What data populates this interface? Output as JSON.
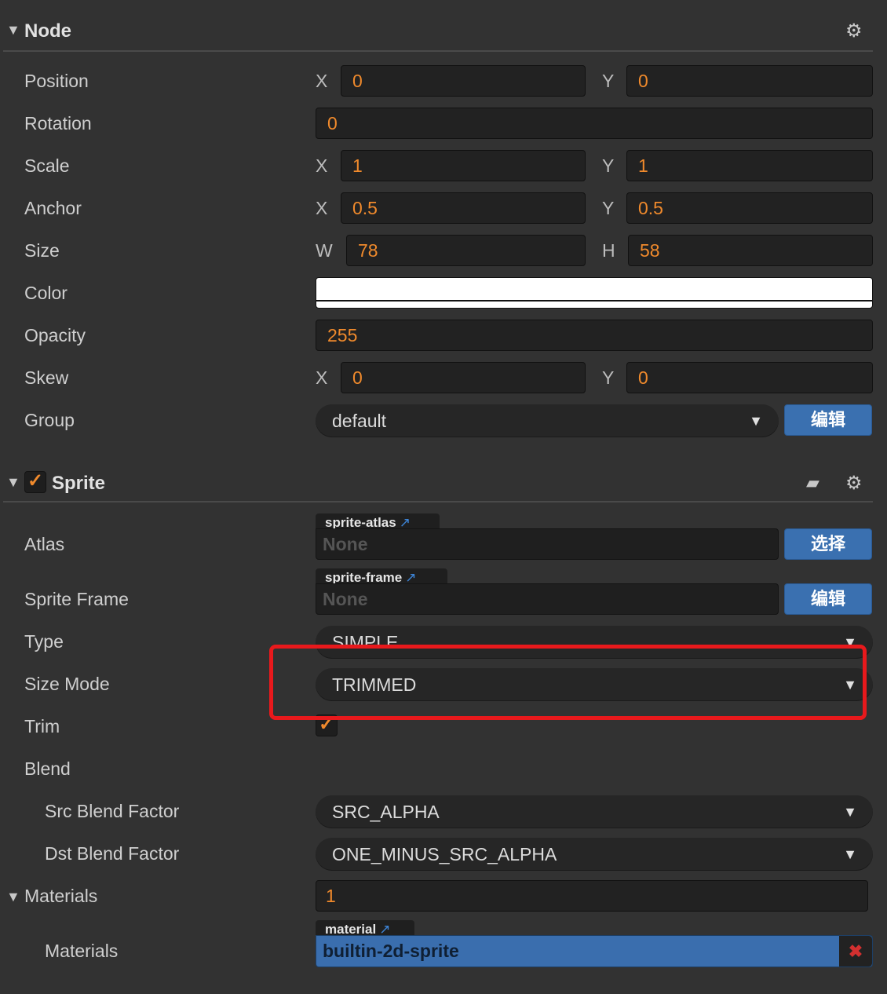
{
  "node": {
    "title": "Node",
    "collapse_icon": "triangle-down-icon",
    "settings_icon": "gear-icon",
    "position": {
      "label": "Position",
      "x_label": "X",
      "x": "0",
      "y_label": "Y",
      "y": "0"
    },
    "rotation": {
      "label": "Rotation",
      "value": "0"
    },
    "scale": {
      "label": "Scale",
      "x_label": "X",
      "x": "1",
      "y_label": "Y",
      "y": "1"
    },
    "anchor": {
      "label": "Anchor",
      "x_label": "X",
      "x": "0.5",
      "y_label": "Y",
      "y": "0.5"
    },
    "size": {
      "label": "Size",
      "w_label": "W",
      "w": "78",
      "h_label": "H",
      "h": "58"
    },
    "color": {
      "label": "Color",
      "value": "#ffffff"
    },
    "opacity": {
      "label": "Opacity",
      "value": "255"
    },
    "skew": {
      "label": "Skew",
      "x_label": "X",
      "x": "0",
      "y_label": "Y",
      "y": "0"
    },
    "group": {
      "label": "Group",
      "value": "default",
      "edit_button": "编辑"
    }
  },
  "sprite": {
    "title": "Sprite",
    "enabled": true,
    "doc_icon": "book-icon",
    "settings_icon": "gear-icon",
    "atlas": {
      "label": "Atlas",
      "tag": "sprite-atlas",
      "value": "None",
      "button": "选择"
    },
    "sprite_frame": {
      "label": "Sprite Frame",
      "tag": "sprite-frame",
      "value": "None",
      "button": "编辑"
    },
    "type": {
      "label": "Type",
      "value": "SIMPLE"
    },
    "size_mode": {
      "label": "Size Mode",
      "value": "TRIMMED"
    },
    "trim": {
      "label": "Trim",
      "checked": true
    },
    "blend": {
      "label": "Blend"
    },
    "src_blend": {
      "label": "Src Blend Factor",
      "value": "SRC_ALPHA"
    },
    "dst_blend": {
      "label": "Dst Blend Factor",
      "value": "ONE_MINUS_SRC_ALPHA"
    },
    "materials": {
      "label": "Materials",
      "count": "1",
      "item_label": "Materials",
      "tag": "material",
      "value": "builtin-2d-sprite",
      "remove_icon": "close-icon"
    }
  },
  "colors": {
    "background": "#323232",
    "value_text": "#f08a2c",
    "button_blue": "#3a70b0",
    "highlight_box": "#e8191c"
  }
}
